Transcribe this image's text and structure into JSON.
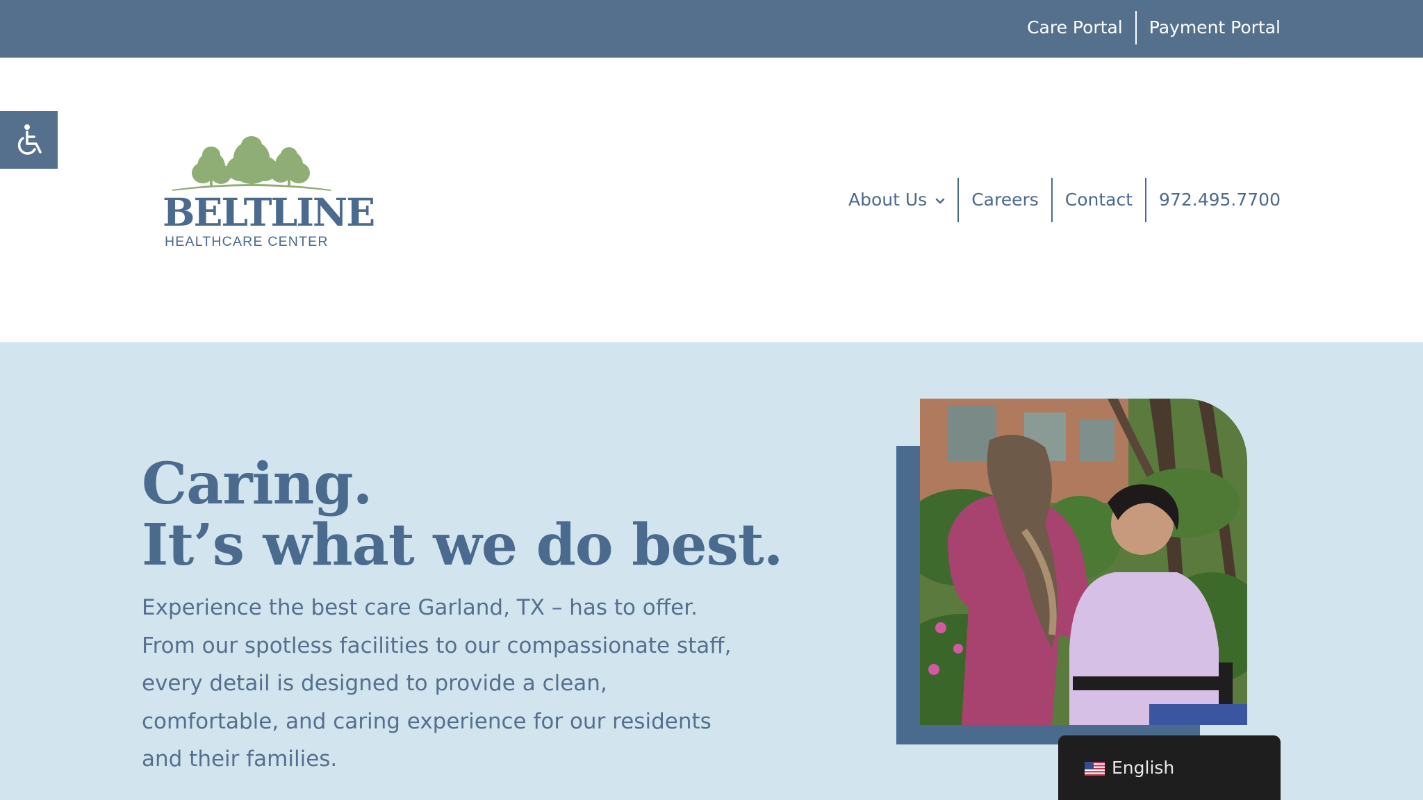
{
  "topbar": {
    "links": [
      "Care Portal",
      "Payment Portal"
    ]
  },
  "accessibility": {
    "icon": "wheelchair-icon"
  },
  "logo": {
    "name": "BELTLINE",
    "subtitle": "HEALTHCARE CENTER",
    "icon": "trees-icon"
  },
  "nav": {
    "about": "About Us",
    "careers": "Careers",
    "contact": "Contact",
    "phone": "972.495.7700"
  },
  "hero": {
    "title_line1": "Caring.",
    "title_line2": "It’s what we do best.",
    "text": "Experience the best care Garland, TX – has to offer. From our spotless facilities to our compassionate staff, every detail is designed to provide a clean, comfortable, and caring experience for our residents and their families."
  },
  "language": {
    "label": "English",
    "flag_icon": "us-flag-icon"
  },
  "colors": {
    "brand_blue": "#55708d",
    "heading_blue": "#4a6a8e",
    "hero_bg": "#d2e5ee",
    "logo_green": "#8fae76"
  }
}
